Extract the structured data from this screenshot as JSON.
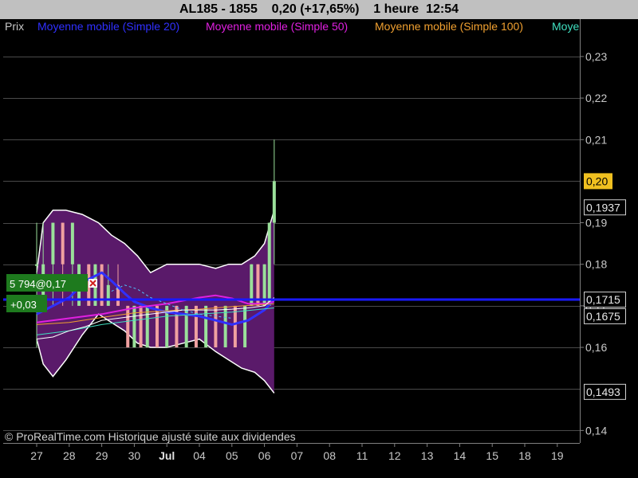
{
  "header": {
    "symbol": "AL185 - 1855",
    "last": "0,20 (+17,65%)",
    "interval": "1 heure",
    "time": "12:54"
  },
  "legend": [
    {
      "label": "Prix",
      "color": "#c8c8c8"
    },
    {
      "label": "Moyenne mobile (Simple 20)",
      "color": "#3030ff"
    },
    {
      "label": "Moyenne mobile (Simple 50)",
      "color": "#e020e0"
    },
    {
      "label": "Moyenne mobile (Simple 100)",
      "color": "#f0a030"
    },
    {
      "label": "Moye",
      "color": "#40e0c0"
    }
  ],
  "position_tag": {
    "text": "5 794@0,17",
    "pnl": "+0,03",
    "close_icon": "close-icon",
    "color": "#1e7a1e"
  },
  "copyright": "© ProRealTime.com Historique ajusté suite aux dividendes",
  "colors": {
    "bollinger_fill": "#5a1a6a",
    "bull": "#9ae09a",
    "bear": "#f0a0a0",
    "grid": "#4a4a4a",
    "last_price_tag": "#f0c020",
    "sma20": "#3030ff",
    "sma50": "#e020e0",
    "sma100": "#f0a030"
  },
  "chart_data": {
    "type": "line",
    "y_axis": {
      "min": 0.137,
      "max": 0.239,
      "ticks": [
        0.14,
        0.16,
        0.17,
        0.18,
        0.19,
        0.21,
        0.22,
        0.23
      ],
      "tick_labels": [
        "0,14",
        "0,16",
        "0,17",
        "0,18",
        "0,19",
        "0,21",
        "0,22",
        "0,23"
      ]
    },
    "x_axis": {
      "labels": [
        "27",
        "28",
        "29",
        "30",
        "Jul",
        "04",
        "05",
        "06",
        "07",
        "08",
        "11",
        "12",
        "13",
        "14",
        "15",
        "18",
        "19"
      ],
      "bold_label": "Jul"
    },
    "value_tags": [
      {
        "value": 0.2,
        "label": "0,20",
        "style": "last"
      },
      {
        "value": 0.1937,
        "label": "0,1937",
        "style": "outline"
      },
      {
        "value": 0.1715,
        "label": "0,1715",
        "style": "outline"
      },
      {
        "value": 0.1675,
        "label": "0,1675",
        "style": "outline"
      },
      {
        "value": 0.1493,
        "label": "0,1493",
        "style": "outline"
      }
    ],
    "price_line": 0.1715,
    "bollinger": {
      "x": [
        0,
        0.2,
        0.5,
        0.9,
        1.4,
        1.9,
        2.3,
        2.7,
        3.1,
        3.5,
        4.0,
        4.5,
        5.0,
        5.5,
        5.9,
        6.3,
        6.7,
        7.0,
        7.3
      ],
      "upper": [
        0.178,
        0.19,
        0.193,
        0.193,
        0.192,
        0.19,
        0.187,
        0.185,
        0.182,
        0.178,
        0.18,
        0.18,
        0.18,
        0.179,
        0.18,
        0.18,
        0.182,
        0.185,
        0.193
      ],
      "lower": [
        0.162,
        0.156,
        0.153,
        0.157,
        0.163,
        0.168,
        0.166,
        0.164,
        0.161,
        0.16,
        0.16,
        0.161,
        0.162,
        0.159,
        0.157,
        0.155,
        0.154,
        0.152,
        0.149
      ]
    },
    "candles": [
      {
        "x": 0.0,
        "o": 0.18,
        "c": 0.18,
        "h": 0.19,
        "l": 0.16
      },
      {
        "x": 0.2,
        "o": 0.17,
        "c": 0.18,
        "h": 0.19,
        "l": 0.17
      },
      {
        "x": 0.5,
        "o": 0.18,
        "c": 0.19,
        "h": 0.19,
        "l": 0.17
      },
      {
        "x": 0.8,
        "o": 0.19,
        "c": 0.18,
        "h": 0.19,
        "l": 0.17
      },
      {
        "x": 1.1,
        "o": 0.18,
        "c": 0.19,
        "h": 0.19,
        "l": 0.17
      },
      {
        "x": 1.3,
        "o": 0.17,
        "c": 0.18,
        "h": 0.18,
        "l": 0.17
      },
      {
        "x": 1.6,
        "o": 0.18,
        "c": 0.17,
        "h": 0.18,
        "l": 0.17
      },
      {
        "x": 1.8,
        "o": 0.17,
        "c": 0.18,
        "h": 0.18,
        "l": 0.17
      },
      {
        "x": 2.0,
        "o": 0.18,
        "c": 0.17,
        "h": 0.18,
        "l": 0.17
      },
      {
        "x": 2.2,
        "o": 0.17,
        "c": 0.175,
        "h": 0.18,
        "l": 0.17
      },
      {
        "x": 2.5,
        "o": 0.175,
        "c": 0.17,
        "h": 0.18,
        "l": 0.17
      },
      {
        "x": 2.8,
        "o": 0.17,
        "c": 0.16,
        "h": 0.17,
        "l": 0.16
      },
      {
        "x": 3.0,
        "o": 0.16,
        "c": 0.17,
        "h": 0.17,
        "l": 0.16
      },
      {
        "x": 3.2,
        "o": 0.17,
        "c": 0.16,
        "h": 0.17,
        "l": 0.16
      },
      {
        "x": 3.4,
        "o": 0.16,
        "c": 0.17,
        "h": 0.17,
        "l": 0.16
      },
      {
        "x": 3.7,
        "o": 0.17,
        "c": 0.16,
        "h": 0.17,
        "l": 0.16
      },
      {
        "x": 4.0,
        "o": 0.16,
        "c": 0.17,
        "h": 0.17,
        "l": 0.16
      },
      {
        "x": 4.3,
        "o": 0.17,
        "c": 0.16,
        "h": 0.17,
        "l": 0.16
      },
      {
        "x": 4.6,
        "o": 0.16,
        "c": 0.17,
        "h": 0.17,
        "l": 0.16
      },
      {
        "x": 4.9,
        "o": 0.17,
        "c": 0.16,
        "h": 0.17,
        "l": 0.16
      },
      {
        "x": 5.2,
        "o": 0.16,
        "c": 0.17,
        "h": 0.17,
        "l": 0.16
      },
      {
        "x": 5.5,
        "o": 0.17,
        "c": 0.16,
        "h": 0.17,
        "l": 0.16
      },
      {
        "x": 5.8,
        "o": 0.16,
        "c": 0.17,
        "h": 0.17,
        "l": 0.16
      },
      {
        "x": 6.1,
        "o": 0.17,
        "c": 0.16,
        "h": 0.17,
        "l": 0.16
      },
      {
        "x": 6.4,
        "o": 0.16,
        "c": 0.17,
        "h": 0.17,
        "l": 0.16
      },
      {
        "x": 6.6,
        "o": 0.17,
        "c": 0.18,
        "h": 0.18,
        "l": 0.17
      },
      {
        "x": 6.8,
        "o": 0.18,
        "c": 0.17,
        "h": 0.18,
        "l": 0.17
      },
      {
        "x": 7.0,
        "o": 0.17,
        "c": 0.18,
        "h": 0.18,
        "l": 0.17
      },
      {
        "x": 7.15,
        "o": 0.17,
        "c": 0.19,
        "h": 0.19,
        "l": 0.17
      },
      {
        "x": 7.3,
        "o": 0.19,
        "c": 0.2,
        "h": 0.21,
        "l": 0.18
      }
    ],
    "series": [
      {
        "name": "Moyenne mobile (Simple 20)",
        "color": "#3030ff",
        "width": 3,
        "x": [
          0,
          0.5,
          1.0,
          1.5,
          2.0,
          2.3,
          2.7,
          3.0,
          3.5,
          4.0,
          4.5,
          5.0,
          5.5,
          6.0,
          6.5,
          7.0,
          7.3
        ],
        "y": [
          0.168,
          0.17,
          0.172,
          0.176,
          0.178,
          0.176,
          0.173,
          0.171,
          0.1695,
          0.1685,
          0.168,
          0.1675,
          0.1665,
          0.1655,
          0.1665,
          0.169,
          0.1715
        ]
      },
      {
        "name": "Moyenne mobile (Simple 50)",
        "color": "#e020e0",
        "width": 2,
        "x": [
          0,
          1.0,
          2.0,
          3.0,
          4.0,
          5.0,
          5.5,
          6.0,
          6.5,
          7.0,
          7.3
        ],
        "y": [
          0.166,
          0.167,
          0.168,
          0.1695,
          0.1705,
          0.172,
          0.1725,
          0.1718,
          0.1705,
          0.1705,
          0.171
        ]
      },
      {
        "name": "Moyenne mobile (Simple 100)",
        "color": "#f0a030",
        "width": 1,
        "x": [
          0,
          1.0,
          2.0,
          3.0,
          4.0,
          5.0,
          6.0,
          7.3
        ],
        "y": [
          0.1655,
          0.166,
          0.1672,
          0.1683,
          0.1688,
          0.1692,
          0.1698,
          0.1705
        ]
      },
      {
        "name": "Moye",
        "color": "#40e0c0",
        "width": 1,
        "x": [
          0,
          1.0,
          2.0,
          3.0,
          4.0,
          5.0,
          6.0,
          7.3
        ],
        "y": [
          0.163,
          0.164,
          0.1655,
          0.1665,
          0.1675,
          0.168,
          0.1685,
          0.1695
        ]
      },
      {
        "name": "",
        "color": "#ffffff",
        "width": 1,
        "role": "bollinger-mid",
        "x": [
          0,
          0.5,
          1.0,
          1.5,
          2.0,
          2.5,
          3.0,
          3.5,
          4.0,
          4.5,
          5.0,
          5.5,
          6.0,
          6.5,
          7.0,
          7.3
        ],
        "y": [
          0.162,
          0.1625,
          0.164,
          0.165,
          0.1665,
          0.167,
          0.1675,
          0.168,
          0.1685,
          0.169,
          0.169,
          0.169,
          0.1692,
          0.1695,
          0.17,
          0.172
        ]
      },
      {
        "name": "",
        "color": "#4fc0ff",
        "width": 1,
        "dash": true,
        "role": "dotted",
        "x": [
          2.3,
          2.7,
          3.1,
          3.5,
          4.0,
          4.5,
          5.0,
          5.5,
          6.0
        ],
        "y": [
          0.1735,
          0.175,
          0.174,
          0.172,
          0.1705,
          0.169,
          0.168,
          0.1675,
          0.167
        ]
      }
    ]
  }
}
